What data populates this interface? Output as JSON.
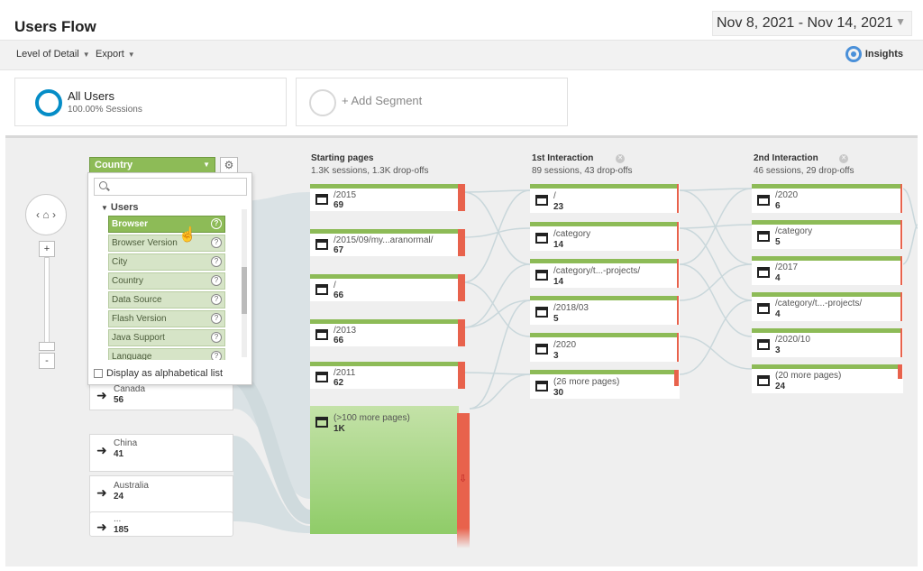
{
  "header": {
    "title": "Users Flow",
    "date_range": "Nov 8, 2021 - Nov 14, 2021"
  },
  "toolbar": {
    "level_of_detail": "Level of Detail",
    "export": "Export",
    "insights": "Insights"
  },
  "segments": [
    {
      "name": "All Users",
      "sub": "100.00% Sessions"
    },
    {
      "name": "+ Add Segment"
    }
  ],
  "dimension_picker": {
    "selected": "Country",
    "search_placeholder": "",
    "group": "Users",
    "items": [
      "Browser",
      "Browser Version",
      "City",
      "Country",
      "Data Source",
      "Flash Version",
      "Java Support",
      "Language"
    ],
    "highlighted": "Browser",
    "alphabetical_label": "Display as alphabetical list"
  },
  "countries": [
    {
      "name": "Canada",
      "count": "56"
    },
    {
      "name": "China",
      "count": "41"
    },
    {
      "name": "Australia",
      "count": "24"
    },
    {
      "name": "...",
      "count": "185"
    }
  ],
  "columns": [
    {
      "title": "Starting pages",
      "sub": "1.3K sessions, 1.3K drop-offs",
      "nodes": [
        {
          "name": "/2015",
          "count": "69"
        },
        {
          "name": "/2015/09/my...aranormal/",
          "count": "67"
        },
        {
          "name": "/",
          "count": "66"
        },
        {
          "name": "/2013",
          "count": "66"
        },
        {
          "name": "/2011",
          "count": "62"
        },
        {
          "name": "(>100 more pages)",
          "count": "1K"
        }
      ]
    },
    {
      "title": "1st Interaction",
      "sub": "89 sessions, 43 drop-offs",
      "nodes": [
        {
          "name": "/",
          "count": "23"
        },
        {
          "name": "/category",
          "count": "14"
        },
        {
          "name": "/category/t...-projects/",
          "count": "14"
        },
        {
          "name": "/2018/03",
          "count": "5"
        },
        {
          "name": "/2020",
          "count": "3"
        },
        {
          "name": "(26 more pages)",
          "count": "30"
        }
      ]
    },
    {
      "title": "2nd Interaction",
      "sub": "46 sessions, 29 drop-offs",
      "nodes": [
        {
          "name": "/2020",
          "count": "6"
        },
        {
          "name": "/category",
          "count": "5"
        },
        {
          "name": "/2017",
          "count": "4"
        },
        {
          "name": "/category/t...-projects/",
          "count": "4"
        },
        {
          "name": "/2020/10",
          "count": "3"
        },
        {
          "name": "(20 more pages)",
          "count": "24"
        }
      ]
    }
  ],
  "colors": {
    "green": "#8dbb57",
    "dropoff": "#e8624c",
    "segment_ring": "#058dc7",
    "flow_band": "#d7e0e3"
  }
}
